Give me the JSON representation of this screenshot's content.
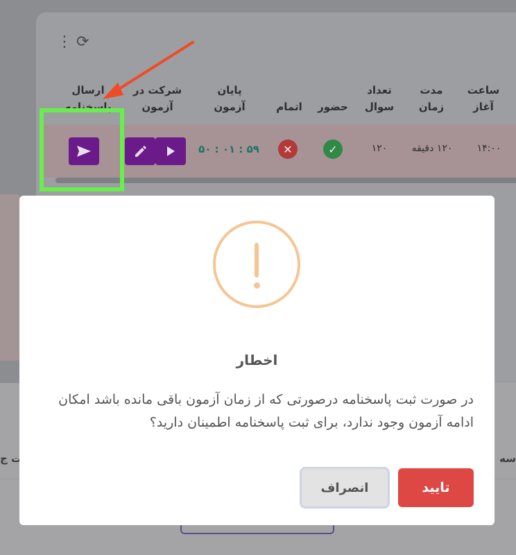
{
  "table": {
    "headers": {
      "submit_answers": "ارسال پاسخنامه",
      "join_exam": "شرکت در آزمون",
      "exam_end": "پایان آزمون",
      "completion": "اتمام",
      "attendance": "حضور",
      "question_count": "تعداد سوال",
      "duration": "مدت زمان",
      "start_time": "ساعت آغاز"
    },
    "row": {
      "remaining_time": "۵۹ : ۰۱ : ۵۰",
      "question_count": "۱۲۰",
      "duration": "۱۲۰ دقیقه",
      "start_time": "۱۴:۰۰"
    }
  },
  "background": {
    "right_fragment": "سه",
    "left_fragment": "ت ج"
  },
  "modal": {
    "title": "اخطار",
    "message": "در صورت ثبت پاسخنامه درصورتی که از زمان آزمون باقی مانده باشد امکان ادامه آزمون وجود ندارد، برای ثبت پاسخنامه اطمینان دارید؟",
    "confirm_label": "تایید",
    "cancel_label": "انصراف"
  },
  "icons": {
    "warning": "exclamation-icon",
    "send": "send-icon",
    "edit": "pencil-icon",
    "play": "play-icon",
    "completion": "x-circle-icon",
    "attendance": "check-circle-icon",
    "menu": "kebab-icon",
    "refresh": "refresh-icon"
  },
  "colors": {
    "primary": "#6b1a8a",
    "danger": "#dd4744",
    "warning": "#f5c593",
    "highlight": "#69ee4d",
    "annotation_arrow": "#f04a28"
  }
}
